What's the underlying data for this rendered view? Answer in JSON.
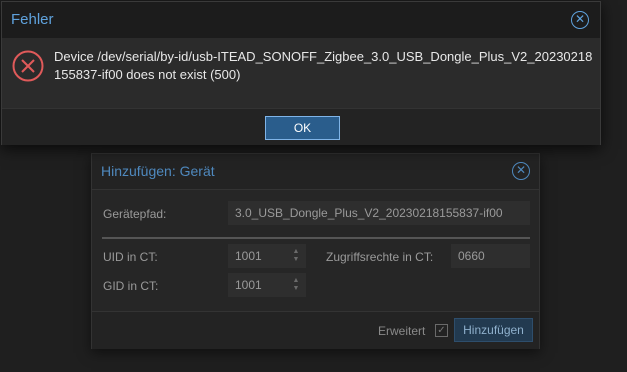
{
  "error_dialog": {
    "title": "Fehler",
    "close_icon": "close-icon",
    "error_icon": "error-x-icon",
    "message": "Device /dev/serial/by-id/usb-ITEAD_SONOFF_Zigbee_3.0_USB_Dongle_Plus_V2_20230218155837-if00 does not exist (500)",
    "ok_label": "OK",
    "accent_color": "#5fa2dd",
    "error_color": "#e05a5a"
  },
  "add_dialog": {
    "title": "Hinzufügen: Gerät",
    "close_icon": "close-icon",
    "device_path_label": "Gerätepfad:",
    "device_path_value": "3.0_USB_Dongle_Plus_V2_20230218155837-if00",
    "uid_label": "UID in CT:",
    "uid_value": "1001",
    "gid_label": "GID in CT:",
    "gid_value": "1001",
    "access_label": "Zugriffsrechte in CT:",
    "access_value": "0660",
    "advanced_label": "Erweitert",
    "advanced_checked": true,
    "submit_label": "Hinzufügen"
  }
}
